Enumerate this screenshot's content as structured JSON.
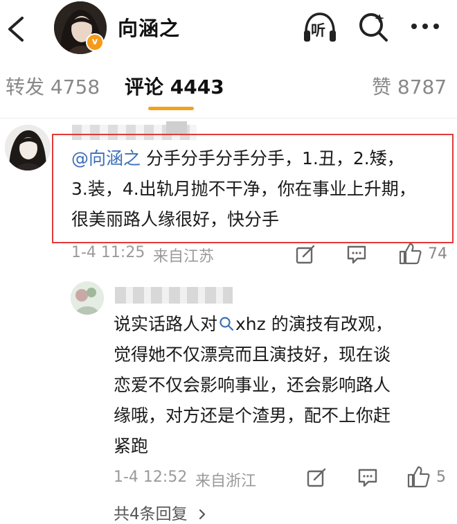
{
  "header": {
    "author_name": "向涵之",
    "verified_badge": "v",
    "icons": [
      "back-icon",
      "listen-icon",
      "search-icon",
      "more-icon"
    ],
    "listen_label": "听",
    "accent_color": "#f4a11d"
  },
  "tabs": [
    {
      "label": "转发 4758",
      "active": false
    },
    {
      "label": "评论 4443",
      "active": true
    },
    {
      "label": "赞 8787",
      "active": false
    }
  ],
  "comment": {
    "mention": "@向涵之",
    "lines": [
      " 分手分手分手分手，1.丑，2.矮，",
      "3.装，4.出轨月抛不干净，你在事业上升期，",
      "很美丽路人缘很好，快分手"
    ],
    "time": "1-4 11:25",
    "location": "来自江苏",
    "like_count": "74",
    "highlight_color": "#e13a3a"
  },
  "reply": {
    "lines": [
      "说实话路人对",
      "xhz 的演技有改观，",
      "觉得她不仅漂亮而且演技好，现在谈",
      "恋爱不仅会影响事业，还会影响路人",
      "缘哦，对方还是个渣男，配不上你赶",
      "紧跑"
    ],
    "time": "1-4 12:52",
    "location": "来自浙江",
    "like_count": "5"
  },
  "more_replies": "共4条回复"
}
